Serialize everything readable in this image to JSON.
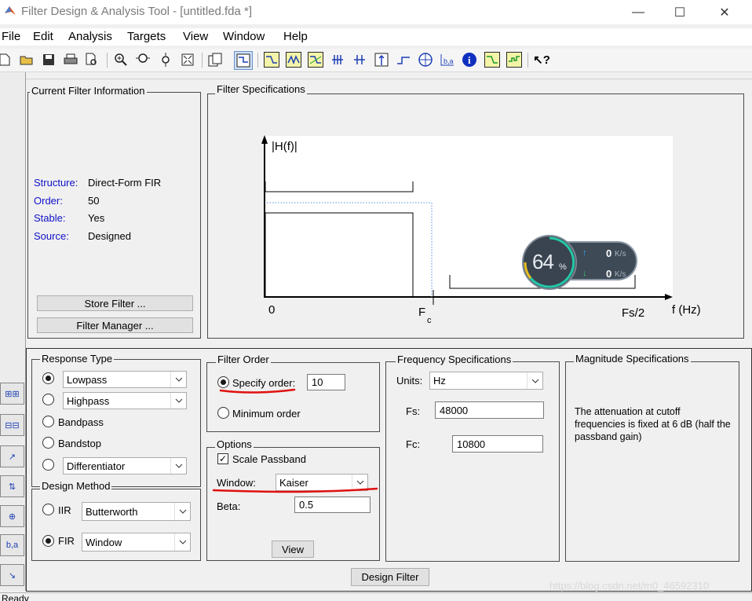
{
  "window": {
    "title": "Filter Design & Analysis Tool -  [untitled.fda *]",
    "minimize": "—",
    "maximize": "☐",
    "close": "✕"
  },
  "menu": [
    "File",
    "Edit",
    "Analysis",
    "Targets",
    "View",
    "Window",
    "Help"
  ],
  "toolbar_icons": [
    "new-icon",
    "open-icon",
    "save-icon",
    "print-icon",
    "print-preview-icon",
    "zoom-in-icon",
    "zoom-x-icon",
    "zoom-y-icon",
    "full-view-icon",
    "new-window-icon",
    "filter-specs-icon",
    "magnitude-response-icon",
    "phase-response-icon",
    "magnitude-phase-icon",
    "group-delay-icon",
    "phase-delay-icon",
    "impulse-response-icon",
    "step-response-icon",
    "pole-zero-icon",
    "coefficients-icon",
    "info-icon",
    "magnitude-estimate-icon",
    "roundoff-noise-icon",
    "whats-this-icon"
  ],
  "current_filter": {
    "title": "Current Filter Information",
    "structure_label": "Structure:",
    "structure_value": "Direct-Form FIR",
    "order_label": "Order:",
    "order_value": "50",
    "stable_label": "Stable:",
    "stable_value": "Yes",
    "source_label": "Source:",
    "source_value": "Designed",
    "store_button": "Store Filter ...",
    "manager_button": "Filter Manager ..."
  },
  "filter_specs": {
    "title": "Filter Specifications",
    "ylabel": "|H(f)|",
    "xlabel": "f (Hz)",
    "tick_zero": "0",
    "tick_fc": "F",
    "tick_fc_sub": "c",
    "tick_fs2": "Fs/2"
  },
  "network_widget": {
    "percent": "64",
    "percent_unit": "%",
    "up_value": "0",
    "down_value": "0",
    "unit": "K/s"
  },
  "response_type": {
    "title": "Response Type",
    "lowpass": "Lowpass",
    "highpass": "Highpass",
    "bandpass": "Bandpass",
    "bandstop": "Bandstop",
    "differentiator": "Differentiator"
  },
  "design_method": {
    "title": "Design Method",
    "iir_label": "IIR",
    "iir_value": "Butterworth",
    "fir_label": "FIR",
    "fir_value": "Window"
  },
  "filter_order": {
    "title": "Filter Order",
    "specify_label": "Specify order:",
    "specify_value": "10",
    "minimum_label": "Minimum order"
  },
  "options": {
    "title": "Options",
    "scale_label": "Scale Passband",
    "window_label": "Window:",
    "window_value": "Kaiser",
    "beta_label": "Beta:",
    "beta_value": "0.5",
    "view_button": "View"
  },
  "frequency_specs": {
    "title": "Frequency Specifications",
    "units_label": "Units:",
    "units_value": "Hz",
    "fs_label": "Fs:",
    "fs_value": "48000",
    "fc_label": "Fc:",
    "fc_value": "10800"
  },
  "magnitude_specs": {
    "title": "Magnitude Specifications",
    "text": "The attenuation at cutoff frequencies is fixed at 6 dB (half the passband gain)"
  },
  "design_button": "Design Filter",
  "status": "Ready",
  "watermark": "https://blog.csdn.net/m0_46592310",
  "colors": {
    "annotation_red": "#e01010",
    "label_blue": "#1010c8"
  }
}
